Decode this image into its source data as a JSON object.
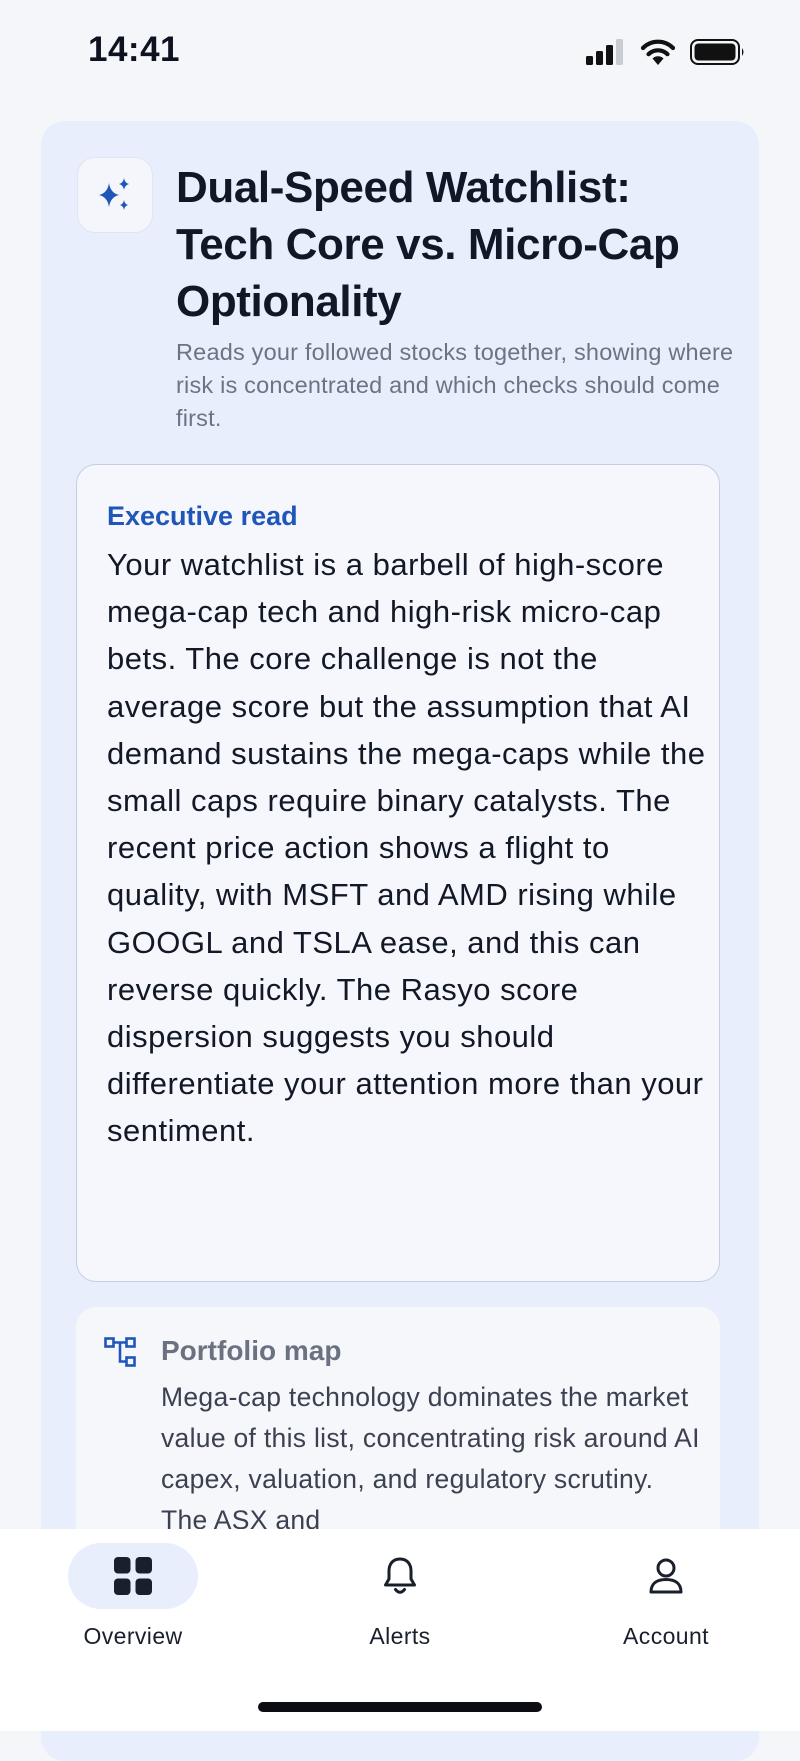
{
  "status_bar": {
    "time": "14:41"
  },
  "header": {
    "icon": "sparkle-icon",
    "title": "Dual-Speed Watchlist: Tech Core vs. Micro-Cap Optionality",
    "subtitle": "Reads your followed stocks together, showing where risk is concentrated and which checks should come first."
  },
  "executive_read": {
    "heading": "Executive read",
    "body": "Your watchlist is a barbell of high-score mega-cap tech and high-risk micro-cap bets. The core challenge is not the average score but the assumption that AI demand sustains the mega-caps while the small caps require binary catalysts. The recent price action shows a flight to quality, with MSFT and AMD rising while GOOGL and TSLA ease, and this can reverse quickly. The Rasyo score dispersion suggests you should differentiate your attention more than your sentiment."
  },
  "portfolio_map": {
    "icon": "hierarchy-icon",
    "heading": "Portfolio map",
    "body": "Mega-cap technology dominates the market value of this list, concentrating risk around AI capex, valuation, and regulatory scrutiny. The ASX and"
  },
  "tab_bar": {
    "tabs": [
      {
        "label": "Overview",
        "icon": "grid-icon",
        "active": true
      },
      {
        "label": "Alerts",
        "icon": "bell-icon",
        "active": false
      },
      {
        "label": "Account",
        "icon": "person-icon",
        "active": false
      }
    ]
  },
  "colors": {
    "accent": "#1f56b8",
    "card_background": "#e9eefc",
    "text": "#121826"
  }
}
